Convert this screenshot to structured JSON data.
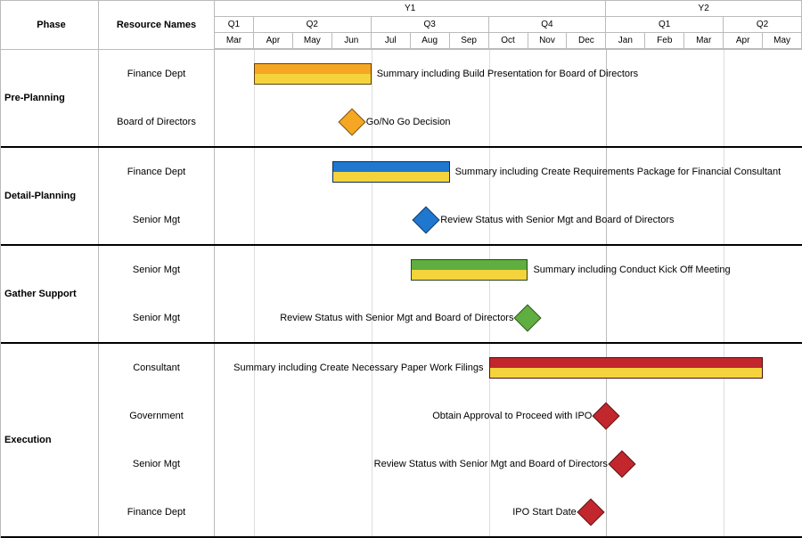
{
  "headers": {
    "phase": "Phase",
    "resource": "Resource Names",
    "years": [
      "Y1",
      "Y2"
    ],
    "quarters": [
      "Q1",
      "Q2",
      "Q3",
      "Q4",
      "Q1",
      "Q2"
    ],
    "quarter_spans": [
      1,
      3,
      3,
      3,
      3,
      2
    ],
    "months": [
      "Mar",
      "Apr",
      "May",
      "Jun",
      "Jul",
      "Aug",
      "Sep",
      "Oct",
      "Nov",
      "Dec",
      "Jan",
      "Feb",
      "Mar",
      "Apr",
      "May"
    ]
  },
  "phases": [
    {
      "name": "Pre-Planning",
      "rows": [
        {
          "resource": "Finance Dept",
          "item": {
            "kind": "bar",
            "start": 1,
            "end": 4,
            "color": "#f5a623",
            "label": "Summary including Build Presentation for Board of Directors",
            "label_side": "right"
          }
        },
        {
          "resource": "Board of Directors",
          "item": {
            "kind": "milestone",
            "at": 3.5,
            "color": "#f5a623",
            "label": "Go/No Go Decision",
            "label_side": "right"
          }
        }
      ]
    },
    {
      "name": "Detail-Planning",
      "rows": [
        {
          "resource": "Finance Dept",
          "item": {
            "kind": "bar",
            "start": 3,
            "end": 6,
            "color": "#1f77d0",
            "label": "Summary including Create Requirements Package for Financial Consultant",
            "label_side": "right"
          }
        },
        {
          "resource": "Senior Mgt",
          "item": {
            "kind": "milestone",
            "at": 5.4,
            "color": "#1f77d0",
            "label": "Review Status with Senior Mgt and Board of Directors",
            "label_side": "right"
          }
        }
      ]
    },
    {
      "name": "Gather Support",
      "rows": [
        {
          "resource": "Senior Mgt",
          "item": {
            "kind": "bar",
            "start": 5,
            "end": 8,
            "color": "#5fae3f",
            "label": "Summary including Conduct Kick Off Meeting",
            "label_side": "right"
          }
        },
        {
          "resource": "Senior Mgt",
          "item": {
            "kind": "milestone",
            "at": 8,
            "color": "#5fae3f",
            "label": "Review Status with Senior Mgt and Board of Directors",
            "label_side": "left"
          }
        }
      ]
    },
    {
      "name": "Execution",
      "rows": [
        {
          "resource": "Consultant",
          "item": {
            "kind": "bar",
            "start": 7,
            "end": 14,
            "color": "#c1272d",
            "label": "Summary including Create Necessary Paper Work Filings",
            "label_side": "left"
          }
        },
        {
          "resource": "Government",
          "item": {
            "kind": "milestone",
            "at": 10,
            "color": "#c1272d",
            "label": "Obtain Approval to Proceed with IPO",
            "label_side": "left"
          }
        },
        {
          "resource": "Senior Mgt",
          "item": {
            "kind": "milestone",
            "at": 10.4,
            "color": "#c1272d",
            "label": "Review Status with Senior Mgt and Board of Directors",
            "label_side": "left"
          }
        },
        {
          "resource": "Finance Dept",
          "item": {
            "kind": "milestone",
            "at": 9.6,
            "color": "#c1272d",
            "label": "IPO Start Date",
            "label_side": "left"
          }
        }
      ]
    }
  ],
  "chart_data": {
    "type": "gantt",
    "title": "",
    "x_months": [
      "Mar",
      "Apr",
      "May",
      "Jun",
      "Jul",
      "Aug",
      "Sep",
      "Oct",
      "Nov",
      "Dec",
      "Jan",
      "Feb",
      "Mar",
      "Apr",
      "May"
    ],
    "x_index_note": "start/end/at are month indices 0..15 aligned to left edge of each month label",
    "series": [
      {
        "phase": "Pre-Planning",
        "resource": "Finance Dept",
        "type": "bar",
        "start": 1,
        "end": 4,
        "color": "#f5a623",
        "label": "Summary including Build Presentation for Board of Directors"
      },
      {
        "phase": "Pre-Planning",
        "resource": "Board of Directors",
        "type": "milestone",
        "at": 3.5,
        "color": "#f5a623",
        "label": "Go/No Go Decision"
      },
      {
        "phase": "Detail-Planning",
        "resource": "Finance Dept",
        "type": "bar",
        "start": 3,
        "end": 6,
        "color": "#1f77d0",
        "label": "Summary including Create Requirements Package for Financial Consultant"
      },
      {
        "phase": "Detail-Planning",
        "resource": "Senior Mgt",
        "type": "milestone",
        "at": 5.4,
        "color": "#1f77d0",
        "label": "Review Status with Senior Mgt and Board of Directors"
      },
      {
        "phase": "Gather Support",
        "resource": "Senior Mgt",
        "type": "bar",
        "start": 5,
        "end": 8,
        "color": "#5fae3f",
        "label": "Summary including Conduct Kick Off Meeting"
      },
      {
        "phase": "Gather Support",
        "resource": "Senior Mgt",
        "type": "milestone",
        "at": 8,
        "color": "#5fae3f",
        "label": "Review Status with Senior Mgt and Board of Directors"
      },
      {
        "phase": "Execution",
        "resource": "Consultant",
        "type": "bar",
        "start": 7,
        "end": 14,
        "color": "#c1272d",
        "label": "Summary including Create Necessary Paper Work Filings"
      },
      {
        "phase": "Execution",
        "resource": "Government",
        "type": "milestone",
        "at": 10,
        "color": "#c1272d",
        "label": "Obtain Approval to Proceed with IPO"
      },
      {
        "phase": "Execution",
        "resource": "Senior Mgt",
        "type": "milestone",
        "at": 10.4,
        "color": "#c1272d",
        "label": "Review Status with Senior Mgt and Board of Directors"
      },
      {
        "phase": "Execution",
        "resource": "Finance Dept",
        "type": "milestone",
        "at": 9.6,
        "color": "#c1272d",
        "label": "IPO Start Date"
      }
    ]
  }
}
